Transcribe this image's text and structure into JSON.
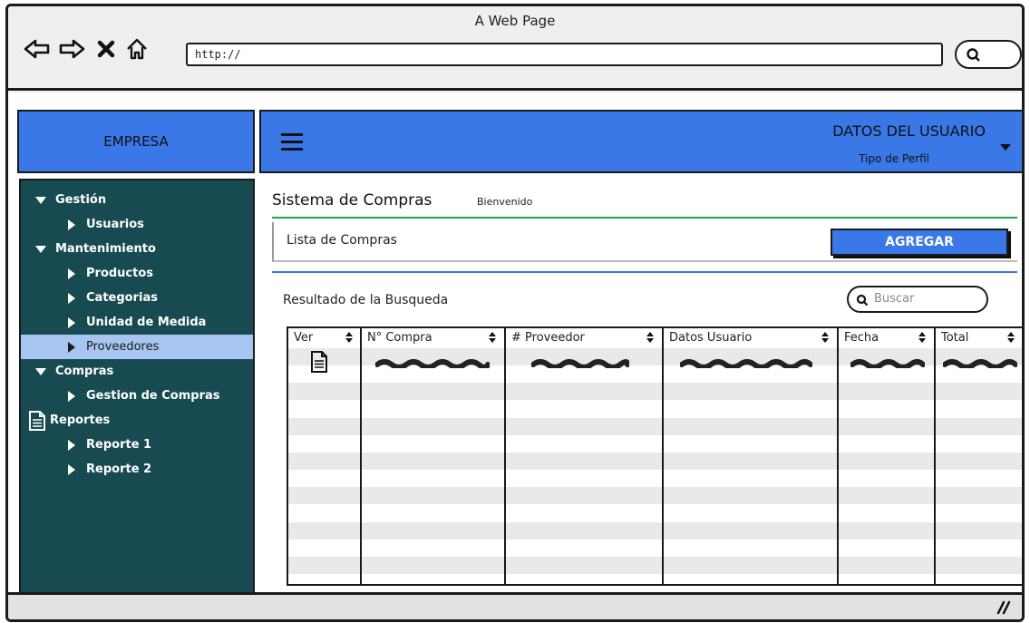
{
  "browser": {
    "window_title": "A Web Page",
    "url": "http://",
    "icons": [
      "back-arrow-icon",
      "forward-arrow-icon",
      "close-x-icon",
      "home-icon",
      "search-icon"
    ]
  },
  "brand": {
    "label": "EMPRESA",
    "color": "#3a78e7"
  },
  "topbar": {
    "user_name": "DATOS DEL USUARIO",
    "profile": "Tipo de Perfil",
    "icons": [
      "hamburger-icon",
      "caret-down-icon"
    ]
  },
  "sidebar": {
    "color": "#184a52",
    "active_color": "#a7c5f0",
    "items": [
      {
        "label": "Gestión",
        "level": 1,
        "icon": "triangle-down-icon"
      },
      {
        "label": "Usuarios",
        "level": 2,
        "icon": "triangle-right-icon"
      },
      {
        "label": "Mantenimiento",
        "level": 1,
        "icon": "triangle-down-icon"
      },
      {
        "label": "Productos",
        "level": 2,
        "icon": "triangle-right-icon"
      },
      {
        "label": "Categorias",
        "level": 2,
        "icon": "triangle-right-icon"
      },
      {
        "label": "Unidad de Medida",
        "level": 2,
        "icon": "triangle-right-icon"
      },
      {
        "label": "Proveedores",
        "level": 2,
        "icon": "triangle-right-icon",
        "active": true
      },
      {
        "label": "Compras",
        "level": 1,
        "icon": "triangle-down-icon"
      },
      {
        "label": "Gestion de Compras",
        "level": 2,
        "icon": "triangle-right-icon"
      },
      {
        "label": "Reportes",
        "level": 1,
        "icon": "document-icon"
      },
      {
        "label": "Reporte 1",
        "level": 2,
        "icon": "triangle-right-icon"
      },
      {
        "label": "Reporte 2",
        "level": 2,
        "icon": "triangle-right-icon"
      }
    ]
  },
  "main": {
    "title": "Sistema de Compras",
    "welcome": "Bienvenido",
    "list_title": "Lista de Compras",
    "add_button": "AGREGAR",
    "results_label": "Resultado de la Busqueda",
    "search_placeholder": "Buscar",
    "table": {
      "columns": [
        "Ver",
        "N° Compra",
        "# Proveedor",
        "Datos Usuario",
        "Fecha",
        "Total"
      ],
      "row_icons": [
        "document-icon"
      ],
      "placeholder_rows": 1,
      "accent_green": "#1aa94a"
    }
  }
}
